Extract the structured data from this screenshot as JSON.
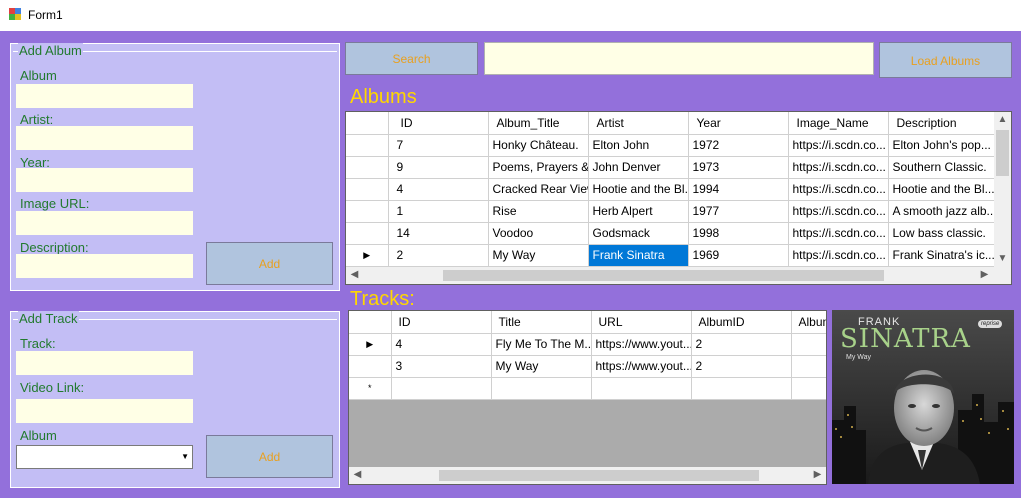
{
  "window": {
    "title": "Form1"
  },
  "add_album": {
    "legend": "Add Album",
    "album_label": "Album",
    "artist_label": "Artist:",
    "year_label": "Year:",
    "image_url_label": "Image URL:",
    "description_label": "Description:",
    "add_label": "Add"
  },
  "add_track": {
    "legend": "Add Track",
    "track_label": "Track:",
    "video_label": "Video Link:",
    "album_label": "Album",
    "add_label": "Add"
  },
  "toolbar": {
    "search_label": "Search",
    "search_value": "",
    "load_label": "Load Albums"
  },
  "albums": {
    "heading": "Albums",
    "columns": [
      "ID",
      "Album_Title",
      "Artist",
      "Year",
      "Image_Name",
      "Description"
    ],
    "rows": [
      [
        "7",
        "Honky Château.",
        "Elton John",
        "1972",
        "https://i.scdn.co...",
        "Elton John's pop..."
      ],
      [
        "9",
        "Poems, Prayers &...",
        "John Denver",
        "1973",
        "https://i.scdn.co...",
        "Southern Classic."
      ],
      [
        "4",
        "Cracked Rear View",
        "Hootie and the Bl...",
        "1994",
        "https://i.scdn.co...",
        "Hootie and the Bl..."
      ],
      [
        "1",
        "Rise",
        "Herb Alpert",
        "1977",
        "https://i.scdn.co...",
        "A smooth jazz alb..."
      ],
      [
        "14",
        "Voodoo",
        "Godsmack",
        "1998",
        "https://i.scdn.co...",
        "Low bass classic."
      ],
      [
        "2",
        "My Way",
        "Frank Sinatra",
        "1969",
        "https://i.scdn.co...",
        "Frank Sinatra's ic..."
      ]
    ],
    "current_row_indicator": "▶"
  },
  "tracks": {
    "heading": "Tracks:",
    "columns": [
      "ID",
      "Title",
      "URL",
      "AlbumID",
      "Album"
    ],
    "rows": [
      [
        "4",
        "Fly Me To The M...",
        "https://www.yout...",
        "2",
        ""
      ],
      [
        "3",
        "My Way",
        "https://www.yout...",
        "2",
        ""
      ]
    ],
    "current_row_indicator": "▶",
    "new_row_indicator": "*"
  },
  "cover": {
    "artist_first": "FRANK",
    "artist_last": "SINATRA",
    "album": "My Way",
    "badge": "reprise"
  },
  "colors": {
    "form_bg": "#9370db",
    "group_bg": "#c3bef5",
    "label_green": "#227a2e",
    "input_bg": "#ffffe6",
    "button_bg": "#b0c4de",
    "button_text": "#e8a020",
    "heading_gold": "#ffd700",
    "selection_blue": "#0078d7"
  }
}
